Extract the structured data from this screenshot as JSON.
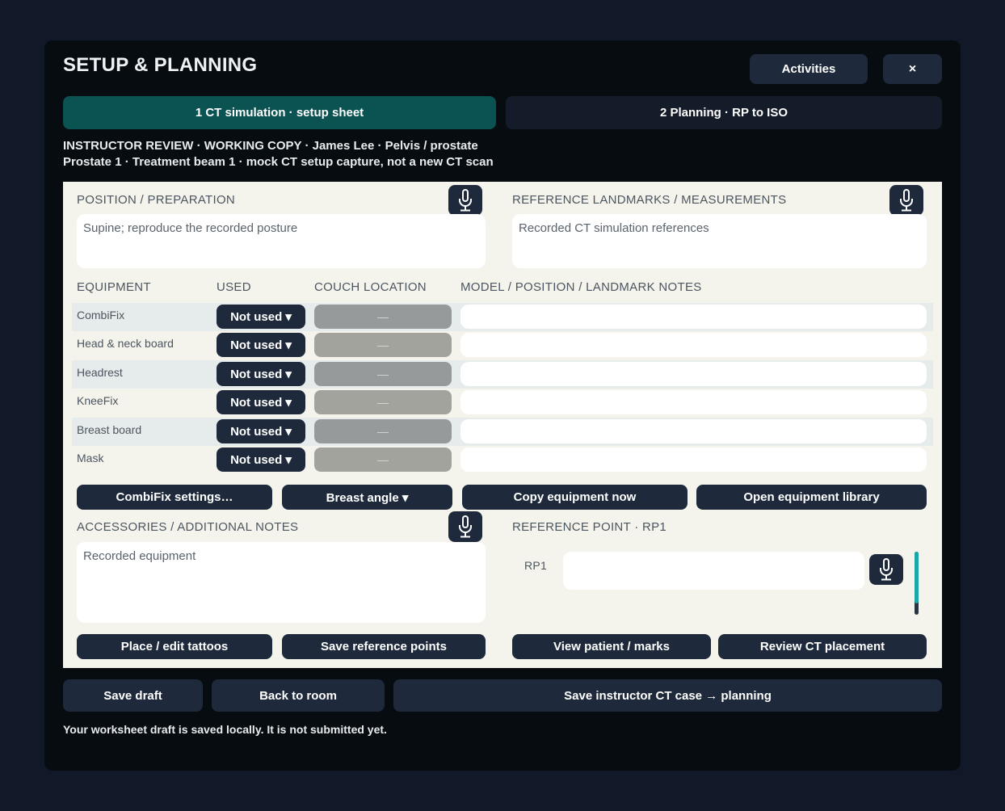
{
  "header": {
    "title": "SETUP & PLANNING",
    "activities_label": "Activities",
    "close_label": "×"
  },
  "tabs": [
    {
      "label": "1  CT simulation · setup sheet",
      "active": true
    },
    {
      "label": "2  Planning · RP to ISO",
      "active": false
    }
  ],
  "review": {
    "line1": "INSTRUCTOR REVIEW · WORKING COPY · James Lee · Pelvis / prostate",
    "line2": "Prostate 1 · Treatment beam 1 · mock CT setup capture, not a new CT scan"
  },
  "position": {
    "label": "POSITION / PREPARATION",
    "value": "Supine; reproduce the recorded posture"
  },
  "landmarks": {
    "label": "REFERENCE LANDMARKS / MEASUREMENTS",
    "value": "Recorded CT simulation references"
  },
  "equipment": {
    "headers": {
      "equipment": "EQUIPMENT",
      "used": "USED",
      "couch": "COUCH LOCATION",
      "notes": "MODEL / POSITION / LANDMARK NOTES"
    },
    "rows": [
      {
        "name": "CombiFix",
        "used": "Not used ▾",
        "couch": "—",
        "notes": ""
      },
      {
        "name": "Head & neck board",
        "used": "Not used ▾",
        "couch": "—",
        "notes": ""
      },
      {
        "name": "Headrest",
        "used": "Not used ▾",
        "couch": "—",
        "notes": ""
      },
      {
        "name": "KneeFix",
        "used": "Not used ▾",
        "couch": "—",
        "notes": ""
      },
      {
        "name": "Breast board",
        "used": "Not used ▾",
        "couch": "—",
        "notes": ""
      },
      {
        "name": "Mask",
        "used": "Not used ▾",
        "couch": "—",
        "notes": ""
      }
    ]
  },
  "equipment_actions": {
    "combifix": "CombiFix settings…",
    "breast_angle": "Breast angle ▾",
    "copy": "Copy equipment now",
    "library": "Open equipment library"
  },
  "accessories": {
    "label": "ACCESSORIES / ADDITIONAL NOTES",
    "value": "Recorded equipment"
  },
  "reference_point": {
    "label": "REFERENCE POINT · RP1",
    "rp_label": "RP1",
    "value": ""
  },
  "sheet_actions": {
    "tattoos": "Place / edit tattoos",
    "save_ref": "Save reference points",
    "view_patient": "View patient / marks",
    "review_ct": "Review CT placement"
  },
  "footer": {
    "save_draft": "Save draft",
    "back": "Back to room",
    "save_case": "Save instructor CT case → planning",
    "status": "Your worksheet draft is saved locally. It is not submitted yet."
  },
  "colors": {
    "accent": "#0b5252",
    "button": "#1e2a3b",
    "sheet": "#f4f3ec",
    "scroll_accent": "#1aa7a7"
  }
}
